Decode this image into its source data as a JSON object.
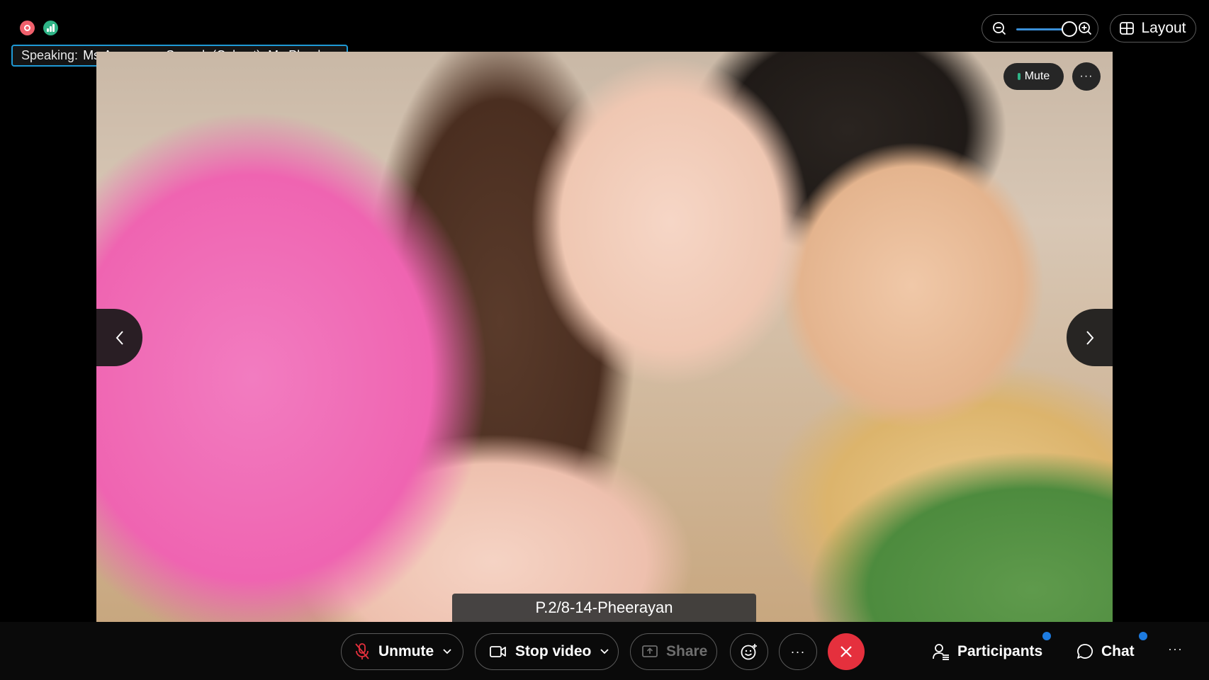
{
  "status": {
    "recording_icon": "record-icon",
    "network_icon": "network-signal-icon"
  },
  "speaking": {
    "label": "Speaking:",
    "names": "Ms.Amornpan Seesuk (Cohost), Ms.Phoch..."
  },
  "zoom": {
    "zoom_out_icon": "zoom-out-icon",
    "zoom_in_icon": "zoom-in-icon"
  },
  "layout": {
    "label": "Layout",
    "icon": "grid-layout-icon"
  },
  "video": {
    "mute_label": "Mute",
    "more_label": "···",
    "participant_name": "P.2/8-14-Pheerayan"
  },
  "toolbar": {
    "unmute_label": "Unmute",
    "stop_video_label": "Stop video",
    "share_label": "Share",
    "more_label": "···",
    "participants_label": "Participants",
    "chat_label": "Chat",
    "overflow_label": "···"
  },
  "colors": {
    "accent_blue": "#1f9ad6",
    "leave_red": "#e5303d",
    "notif_blue": "#1d7be0",
    "status_green": "#2fb487",
    "record_red": "#f0606c"
  }
}
